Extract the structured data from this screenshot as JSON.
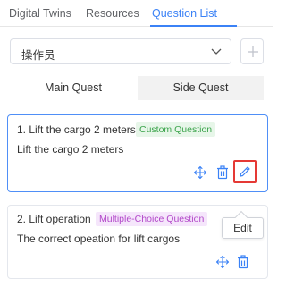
{
  "tabs": [
    {
      "label": "Digital Twins"
    },
    {
      "label": "Resources"
    },
    {
      "label": "Question List",
      "active": true
    }
  ],
  "operator_select": {
    "value": "操作员"
  },
  "quest_toggle": {
    "main": "Main Quest",
    "side": "Side Quest",
    "selected": "Main Quest"
  },
  "questions": [
    {
      "title": "1. Lift the cargo 2 meters",
      "tag": "Custom Question",
      "description": "Lift the cargo 2 meters"
    },
    {
      "title": "2. Lift operation",
      "tag": "Multiple-Choice Question",
      "description": "The correct opeation for lift cargos"
    }
  ],
  "tooltip": {
    "text": "Edit"
  },
  "colors": {
    "accent": "#3b82f6",
    "custom_tag_bg": "#e7f6e9",
    "custom_tag_text": "#3aa34a",
    "mc_tag_bg": "#f5e6fb",
    "mc_tag_text": "#b247c9",
    "highlight": "#e53935"
  }
}
